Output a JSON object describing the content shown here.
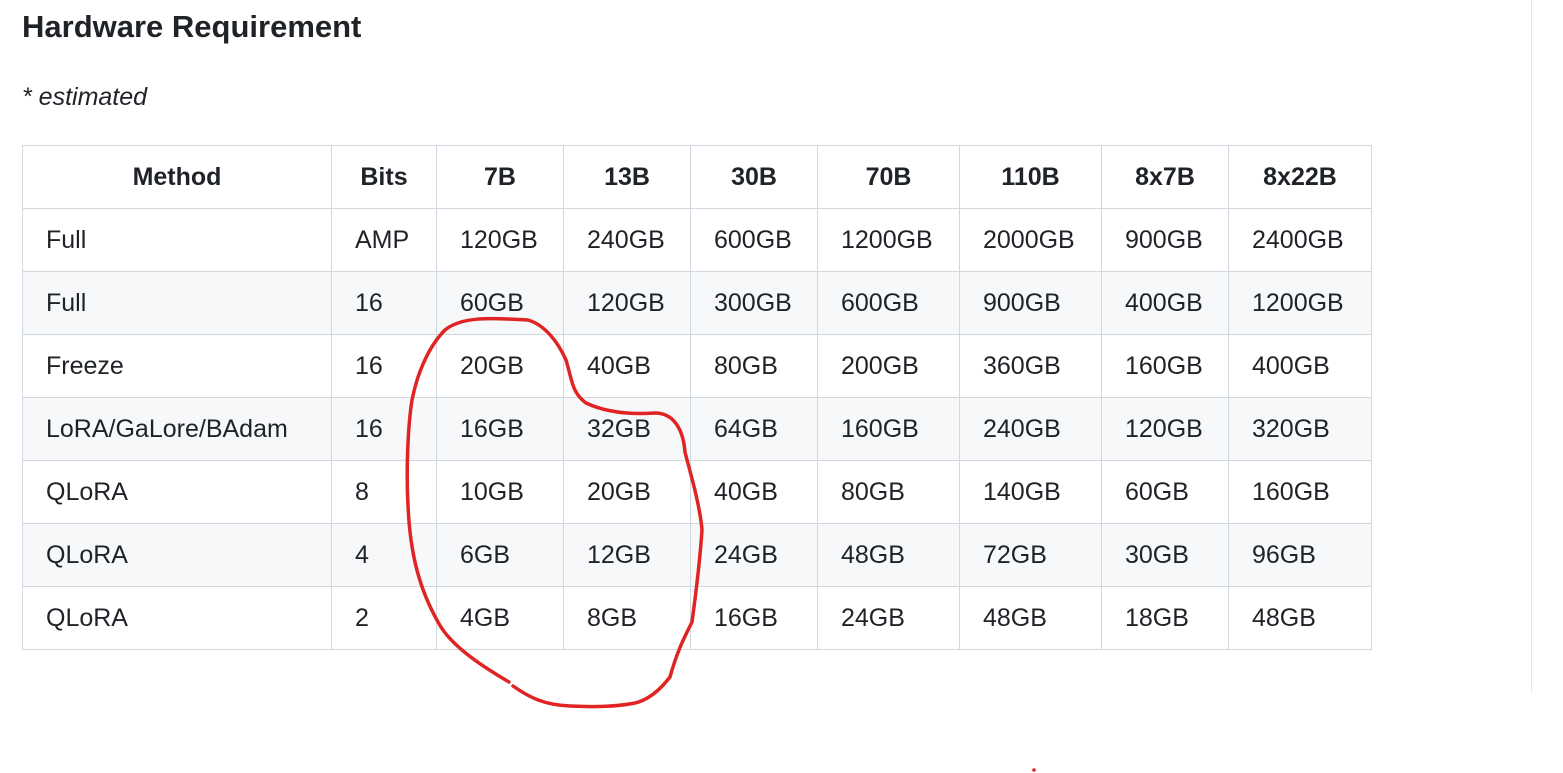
{
  "section": {
    "title": "Hardware Requirement",
    "note": "* estimated"
  },
  "table": {
    "headers": [
      "Method",
      "Bits",
      "7B",
      "13B",
      "30B",
      "70B",
      "110B",
      "8x7B",
      "8x22B"
    ],
    "rows": [
      [
        "Full",
        "AMP",
        "120GB",
        "240GB",
        "600GB",
        "1200GB",
        "2000GB",
        "900GB",
        "2400GB"
      ],
      [
        "Full",
        "16",
        "60GB",
        "120GB",
        "300GB",
        "600GB",
        "900GB",
        "400GB",
        "1200GB"
      ],
      [
        "Freeze",
        "16",
        "20GB",
        "40GB",
        "80GB",
        "200GB",
        "360GB",
        "160GB",
        "400GB"
      ],
      [
        "LoRA/GaLore/BAdam",
        "16",
        "16GB",
        "32GB",
        "64GB",
        "160GB",
        "240GB",
        "120GB",
        "320GB"
      ],
      [
        "QLoRA",
        "8",
        "10GB",
        "20GB",
        "40GB",
        "80GB",
        "140GB",
        "60GB",
        "160GB"
      ],
      [
        "QLoRA",
        "4",
        "6GB",
        "12GB",
        "24GB",
        "48GB",
        "72GB",
        "30GB",
        "96GB"
      ],
      [
        "QLoRA",
        "2",
        "4GB",
        "8GB",
        "16GB",
        "24GB",
        "48GB",
        "18GB",
        "48GB"
      ]
    ]
  },
  "annotation": {
    "stroke_color": "#e02424"
  }
}
